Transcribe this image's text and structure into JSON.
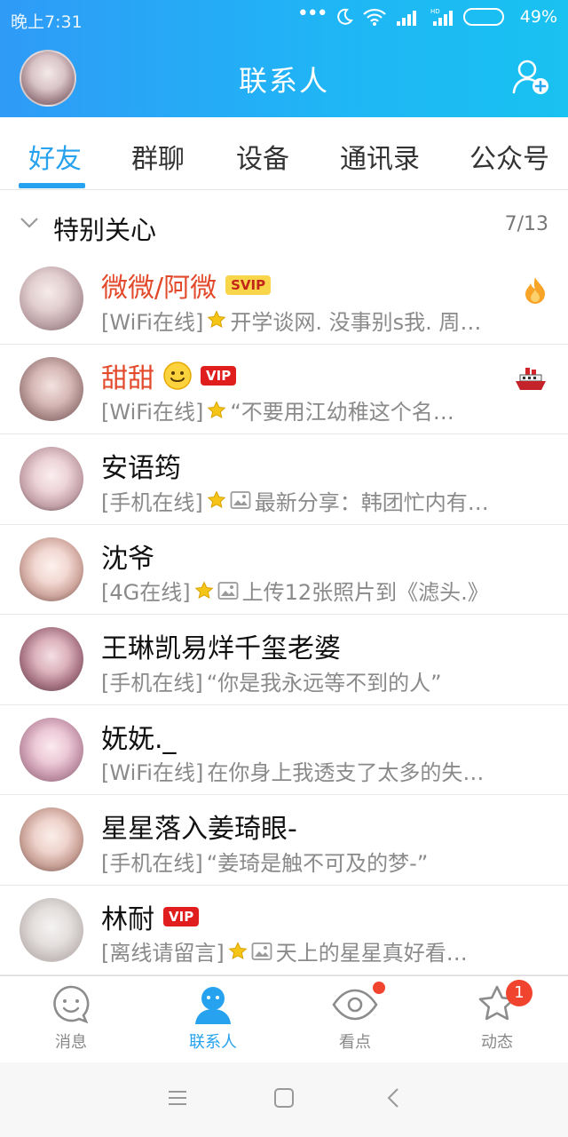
{
  "status_bar": {
    "time": "晚上7:31",
    "battery_pct": "49%",
    "battery_level": 0.49
  },
  "header": {
    "title": "联系人"
  },
  "tabs": [
    {
      "label": "好友",
      "active": true
    },
    {
      "label": "群聊",
      "active": false
    },
    {
      "label": "设备",
      "active": false
    },
    {
      "label": "通讯录",
      "active": false
    },
    {
      "label": "公众号",
      "active": false
    }
  ],
  "group": {
    "title": "特别关心",
    "count": "7/13"
  },
  "contacts": [
    {
      "name": "微微/阿微",
      "badge": "SVIP",
      "status": "[WiFi在线]",
      "signature": "开学谈网. 没事别s我. 周…",
      "right_icon": "fire-icon"
    },
    {
      "name": "甜甜",
      "badge": "VIP",
      "status": "[WiFi在线]",
      "signature": "“不要用江幼稚这个名…",
      "right_icon": "ship-icon"
    },
    {
      "name": "安语筠",
      "status": "[手机在线]",
      "signature": "最新分享：韩团忙内有…"
    },
    {
      "name": "沈爷",
      "status": "[4G在线]",
      "signature": "上传12张照片到《滤头.》"
    },
    {
      "name": "王琳凯易烊千玺老婆",
      "status": "[手机在线]",
      "signature": "“你是我永远等不到的人”"
    },
    {
      "name": "妩妩._",
      "status": "[WiFi在线]",
      "signature": "在你身上我透支了太多的失…"
    },
    {
      "name": "星星落入姜琦眼-",
      "status": "[手机在线]",
      "signature": "“姜琦是触不可及的梦-”"
    },
    {
      "name": "林耐",
      "badge": "VIP",
      "status": "[离线请留言]",
      "signature": "天上的星星真好看…"
    }
  ],
  "bottom_nav": [
    {
      "label": "消息",
      "icon": "message-icon"
    },
    {
      "label": "联系人",
      "icon": "contacts-icon"
    },
    {
      "label": "看点",
      "icon": "eye-icon"
    },
    {
      "label": "动态",
      "icon": "star-icon",
      "badge": "1"
    }
  ],
  "colors": {
    "accent": "#26a2ee",
    "header_start": "#2f9bf7",
    "header_end": "#19c2f0",
    "vip_name": "#e24a2b"
  }
}
